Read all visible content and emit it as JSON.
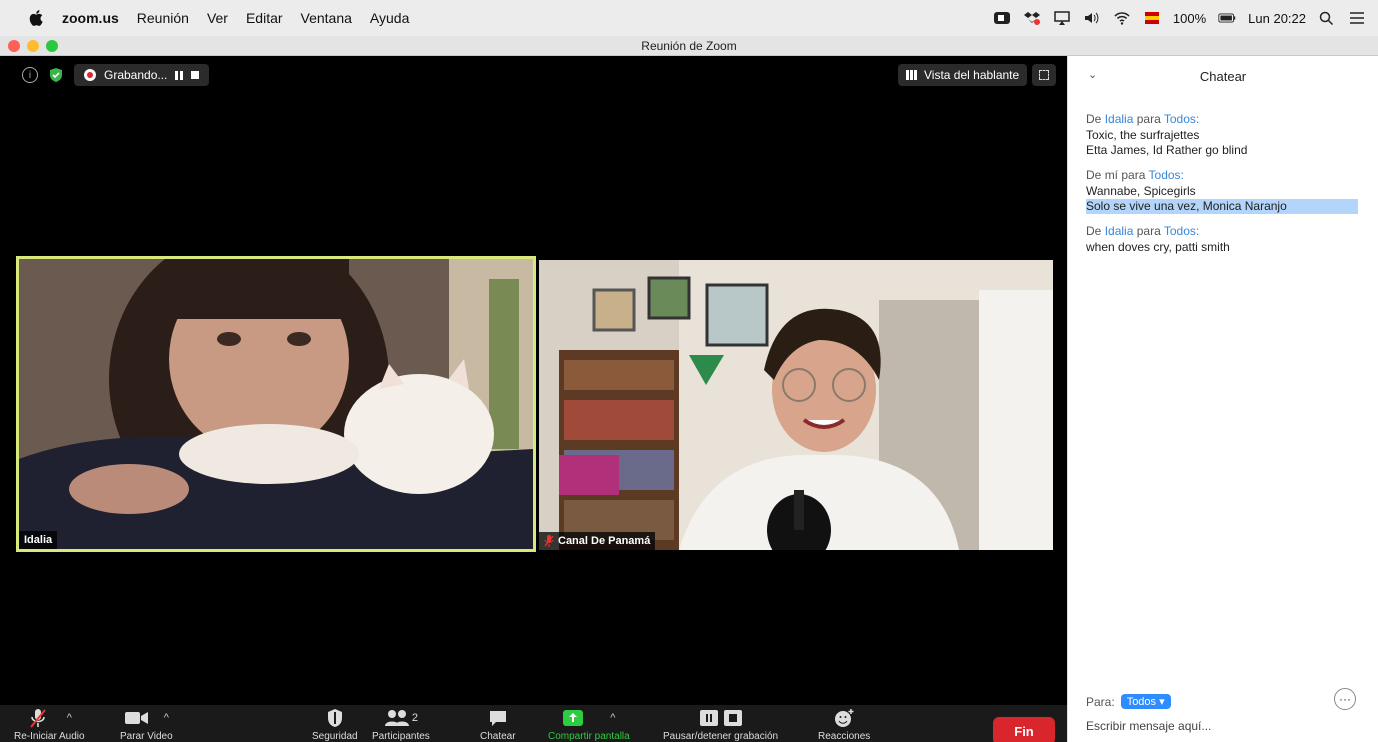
{
  "menubar": {
    "app": "zoom.us",
    "items": [
      "Reunión",
      "Ver",
      "Editar",
      "Ventana",
      "Ayuda"
    ],
    "battery": "100%",
    "clock": "Lun 20:22"
  },
  "window": {
    "title": "Reunión de Zoom"
  },
  "meeting": {
    "recording_label": "Grabando...",
    "speaker_view_label": "Vista del hablante",
    "participants": [
      {
        "name": "Idalia",
        "active_speaker": true,
        "muted": false
      },
      {
        "name": "Canal De Panamá",
        "active_speaker": false,
        "muted": true
      }
    ]
  },
  "toolbar": {
    "audio_label": "Re-Iniciar Audio",
    "video_label": "Parar Video",
    "security_label": "Seguridad",
    "participants_label": "Participantes",
    "participants_count": "2",
    "chat_label": "Chatear",
    "share_label": "Compartir pantalla",
    "record_label": "Pausar/detener grabación",
    "reactions_label": "Reacciones",
    "end_label": "Fin"
  },
  "chat": {
    "title": "Chatear",
    "messages": [
      {
        "from": "Idalia",
        "to": "Todos",
        "lines": [
          "Toxic, the surfrajettes",
          "Etta James, Id Rather go blind"
        ]
      },
      {
        "from": "mí",
        "to": "Todos",
        "lines": [
          "Wannabe, Spicegirls",
          "Solo se vive una vez, Monica Naranjo"
        ]
      },
      {
        "from": "Idalia",
        "to": "Todos",
        "lines": [
          "when doves cry, patti smith"
        ]
      }
    ],
    "de_word": "De",
    "para_word": "para",
    "to_label": "Para:",
    "to_value": "Todos",
    "input_placeholder": "Escribir mensaje aquí..."
  },
  "colors": {
    "accent": "#2d8cff",
    "end": "#d9252c",
    "active_speaker": "#d9e87a",
    "share": "#2ecc40"
  }
}
